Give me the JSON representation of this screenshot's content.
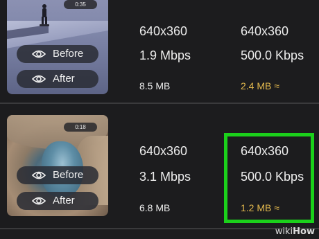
{
  "videos": [
    {
      "duration": "0:35",
      "before_label": "Before",
      "after_label": "After",
      "original": {
        "resolution": "640x360",
        "bitrate": "1.9 Mbps",
        "size": "8.5 MB"
      },
      "compressed": {
        "resolution": "640x360",
        "bitrate": "500.0 Kbps",
        "size": "2.4 MB ≈"
      }
    },
    {
      "duration": "0:18",
      "before_label": "Before",
      "after_label": "After",
      "original": {
        "resolution": "640x360",
        "bitrate": "3.1 Mbps",
        "size": "6.8 MB"
      },
      "compressed": {
        "resolution": "640x360",
        "bitrate": "500.0 Kbps",
        "size": "1.2 MB ≈"
      }
    }
  ],
  "watermark": {
    "wiki": "wiki",
    "how": "How"
  },
  "colors": {
    "background": "#1c1c1e",
    "text": "#ececec",
    "estimate": "#e3b94e",
    "highlight": "#1bd01b"
  }
}
